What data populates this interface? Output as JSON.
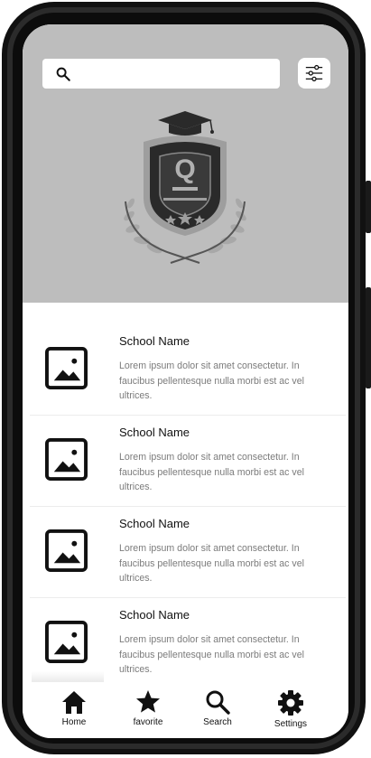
{
  "search": {
    "placeholder": ""
  },
  "schools": [
    {
      "name": "School Name",
      "description": "Lorem ipsum dolor sit amet consectetur. In faucibus pellentesque nulla morbi est ac vel ultrices."
    },
    {
      "name": "School Name",
      "description": "Lorem ipsum dolor sit amet consectetur. In faucibus pellentesque nulla morbi est ac vel ultrices."
    },
    {
      "name": "School Name",
      "description": "Lorem ipsum dolor sit amet consectetur. In faucibus pellentesque nulla morbi est ac vel ultrices."
    },
    {
      "name": "School Name",
      "description": "Lorem ipsum dolor sit amet consectetur. In faucibus pellentesque nulla morbi est ac vel ultrices."
    }
  ],
  "logo": {
    "letter": "Q"
  },
  "nav": [
    {
      "label": "Home",
      "icon": "home-icon"
    },
    {
      "label": "favorite",
      "icon": "star-icon"
    },
    {
      "label": "Search",
      "icon": "search-icon"
    },
    {
      "label": "Settings",
      "icon": "gear-icon"
    }
  ],
  "colors": {
    "header_bg": "#bdbdbd",
    "text": "#111111",
    "muted": "#7b7b7b"
  }
}
